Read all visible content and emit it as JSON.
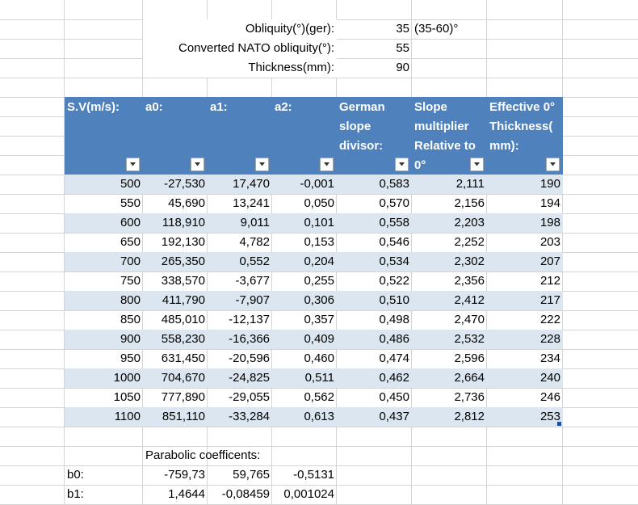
{
  "sheet": {
    "top_info": [
      {
        "label": "Obliquity(°)(ger):",
        "value": "35",
        "note": "(35-60)°"
      },
      {
        "label": "Converted NATO obliquity(°):",
        "value": "55",
        "note": ""
      },
      {
        "label": "Thickness(mm):",
        "value": "90",
        "note": ""
      }
    ],
    "table": {
      "headers": [
        [
          "S.V(m/s):"
        ],
        [
          "a0:"
        ],
        [
          "a1:"
        ],
        [
          "a2:"
        ],
        [
          "German",
          "slope",
          "divisor:"
        ],
        [
          "Slope",
          "multiplier",
          "Relative to",
          "0°"
        ],
        [
          "Effective 0°",
          "Thickness(",
          "mm):"
        ]
      ],
      "rows": [
        [
          "500",
          "-27,530",
          "17,470",
          "-0,001",
          "0,583",
          "2,111",
          "190"
        ],
        [
          "550",
          "45,690",
          "13,241",
          "0,050",
          "0,570",
          "2,156",
          "194"
        ],
        [
          "600",
          "118,910",
          "9,011",
          "0,101",
          "0,558",
          "2,203",
          "198"
        ],
        [
          "650",
          "192,130",
          "4,782",
          "0,153",
          "0,546",
          "2,252",
          "203"
        ],
        [
          "700",
          "265,350",
          "0,552",
          "0,204",
          "0,534",
          "2,302",
          "207"
        ],
        [
          "750",
          "338,570",
          "-3,677",
          "0,255",
          "0,522",
          "2,356",
          "212"
        ],
        [
          "800",
          "411,790",
          "-7,907",
          "0,306",
          "0,510",
          "2,412",
          "217"
        ],
        [
          "850",
          "485,010",
          "-12,137",
          "0,357",
          "0,498",
          "2,470",
          "222"
        ],
        [
          "900",
          "558,230",
          "-16,366",
          "0,409",
          "0,486",
          "2,532",
          "228"
        ],
        [
          "950",
          "631,450",
          "-20,596",
          "0,460",
          "0,474",
          "2,596",
          "234"
        ],
        [
          "1000",
          "704,670",
          "-24,825",
          "0,511",
          "0,462",
          "2,664",
          "240"
        ],
        [
          "1050",
          "777,890",
          "-29,055",
          "0,562",
          "0,450",
          "2,736",
          "246"
        ],
        [
          "1100",
          "851,110",
          "-33,284",
          "0,613",
          "0,437",
          "2,812",
          "253"
        ]
      ]
    },
    "parabolic": {
      "title": "Parabolic coefficents:",
      "rows": [
        {
          "label": "b0:",
          "values": [
            "-759,73",
            "59,765",
            "-0,5131"
          ]
        },
        {
          "label": "b1:",
          "values": [
            "1,4644",
            "-0,08459",
            "0,001024"
          ]
        }
      ]
    },
    "colors": {
      "header_bg": "#4f81bd",
      "band_odd": "#dce6f1",
      "gridline": "#d4d4d4"
    },
    "icons": {
      "filter": "dropdown-arrow-icon",
      "resize": "table-resize-handle-icon"
    }
  }
}
